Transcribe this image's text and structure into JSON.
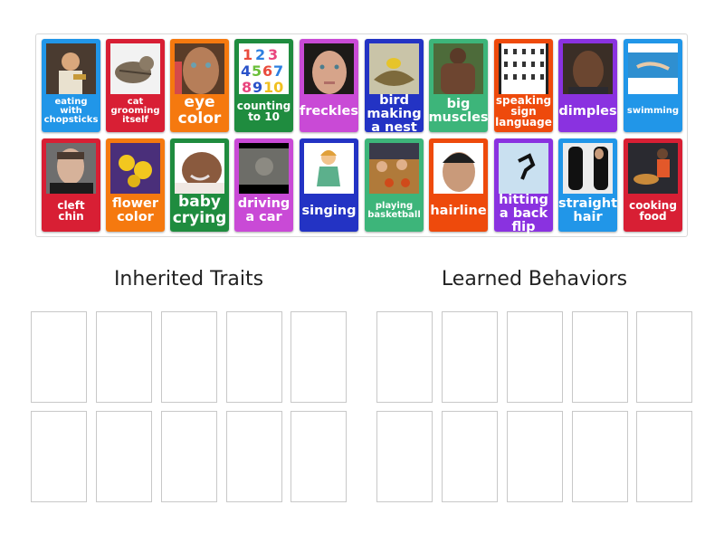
{
  "activity": {
    "type": "group-sort",
    "cards": [
      {
        "label": "eating with chopsticks",
        "image": "child-eating-photo",
        "color": "#2196e8"
      },
      {
        "label": "cat grooming itself",
        "image": "cat-photo",
        "color": "#d81f34"
      },
      {
        "label": "eye color",
        "image": "child-face-photo",
        "color": "#f5790f"
      },
      {
        "label": "counting to 10",
        "image": "numbers-1-10-graphic",
        "color": "#1f8c3f"
      },
      {
        "label": "freckles",
        "image": "freckled-face-photo",
        "color": "#c94ad6"
      },
      {
        "label": "bird making a nest",
        "image": "bird-nest-photo",
        "color": "#2333c4"
      },
      {
        "label": "big muscles",
        "image": "muscular-man-photo",
        "color": "#3db57a"
      },
      {
        "label": "speaking sign language",
        "image": "sign-language-chart",
        "color": "#ee4a0c"
      },
      {
        "label": "dimples",
        "image": "woman-face-photo",
        "color": "#8a32e0"
      },
      {
        "label": "swimming",
        "image": "swimmer-photo",
        "color": "#2196e8"
      },
      {
        "label": "cleft chin",
        "image": "man-face-photo",
        "color": "#d81f34"
      },
      {
        "label": "flower color",
        "image": "yellow-flowers-photo",
        "color": "#f5790f"
      },
      {
        "label": "baby crying",
        "image": "crying-baby-photo",
        "color": "#1f8c3f"
      },
      {
        "label": "driving a car",
        "image": "car-driver-photo",
        "color": "#c94ad6"
      },
      {
        "label": "singing",
        "image": "singing-girl-cartoon",
        "color": "#2333c4"
      },
      {
        "label": "playing basketball",
        "image": "basketball-kids-photo",
        "color": "#3db57a"
      },
      {
        "label": "hairline",
        "image": "man-hairline-photo",
        "color": "#ee4a0c"
      },
      {
        "label": "hitting a back flip",
        "image": "backflip-photo",
        "color": "#8a32e0"
      },
      {
        "label": "straight hair",
        "image": "straight-hair-photo",
        "color": "#2196e8"
      },
      {
        "label": "cooking food",
        "image": "woman-cooking-photo",
        "color": "#d81f34"
      }
    ],
    "groups": [
      {
        "title": "Inherited Traits",
        "slots": 10
      },
      {
        "title": "Learned Behaviors",
        "slots": 10
      }
    ]
  }
}
